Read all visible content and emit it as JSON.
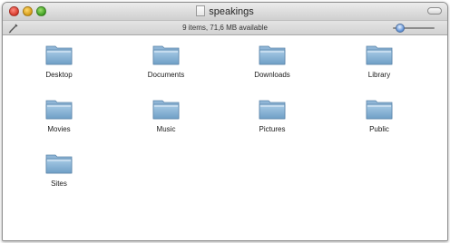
{
  "window": {
    "title": "speakings"
  },
  "statusbar": {
    "text": "9 items, 71,6 MB available",
    "zoom_level": 0.15
  },
  "icons": {
    "folder": "folder-icon",
    "pencil": "pencil-icon"
  },
  "colors": {
    "folder_top": "#a8cbe6",
    "folder_bottom": "#6f9fc6",
    "close": "#d6382b",
    "minimize": "#d49b16",
    "zoom": "#3f9e22"
  },
  "items": [
    {
      "label": "Desktop"
    },
    {
      "label": "Documents"
    },
    {
      "label": "Downloads"
    },
    {
      "label": "Library"
    },
    {
      "label": "Movies"
    },
    {
      "label": "Music"
    },
    {
      "label": "Pictures"
    },
    {
      "label": "Public"
    },
    {
      "label": "Sites"
    }
  ]
}
